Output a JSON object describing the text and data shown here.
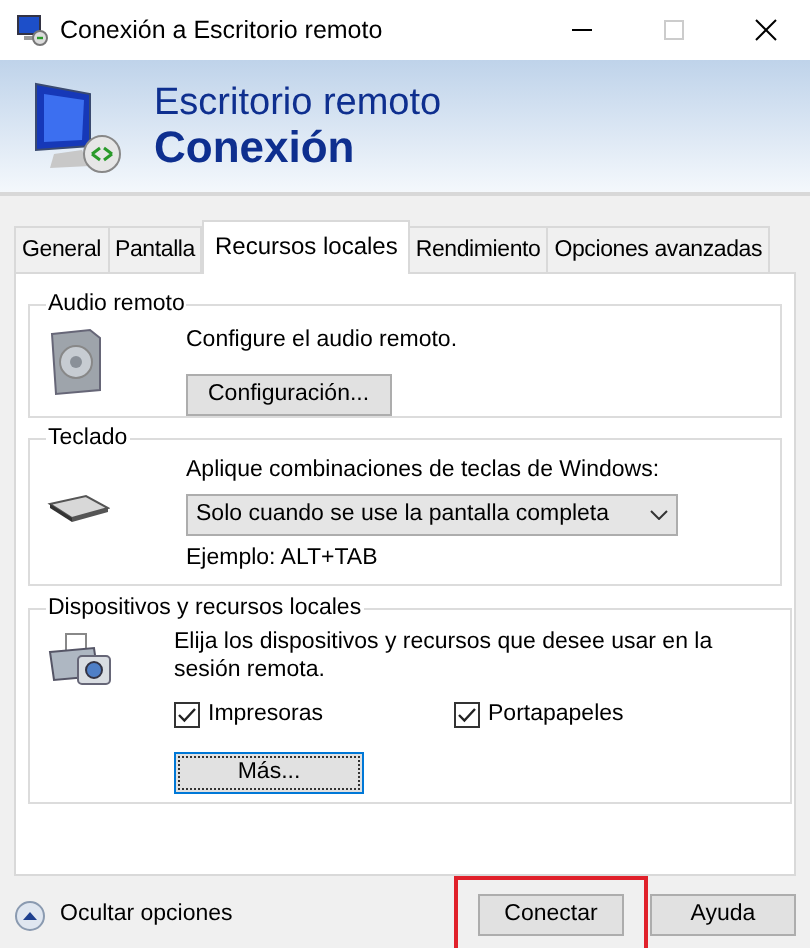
{
  "window": {
    "title": "Conexión a Escritorio remoto"
  },
  "banner": {
    "line_1": "Escritorio remoto",
    "line_2": "Conexión"
  },
  "tabs": [
    {
      "label": "General",
      "selected": false
    },
    {
      "label": "Pantalla",
      "selected": false
    },
    {
      "label": "Recursos locales",
      "selected": true
    },
    {
      "label": "Rendimiento",
      "selected": false
    },
    {
      "label": "Opciones avanzadas",
      "selected": false
    }
  ],
  "audio": {
    "title": "Audio remoto",
    "text": "Configure el audio remoto.",
    "button": "Configuración..."
  },
  "keyboard": {
    "title": "Teclado",
    "text": "Aplique combinaciones de teclas de Windows:",
    "dropdown": "Solo cuando se use la pantalla completa",
    "example": "Ejemplo: ALT+TAB"
  },
  "devices": {
    "title": "Dispositivos y recursos locales",
    "text": "Elija los dispositivos y recursos que desee usar en la sesión remota.",
    "checkboxes": [
      {
        "label": "Impresoras",
        "checked": true
      },
      {
        "label": "Portapapeles",
        "checked": true
      }
    ],
    "button": "Más...",
    "button_focused": true
  },
  "footer": {
    "toggle": "Ocultar opciones",
    "buttons": [
      {
        "label": "Conectar",
        "highlighted": true
      },
      {
        "label": "Ayuda",
        "highlighted": false
      }
    ]
  }
}
